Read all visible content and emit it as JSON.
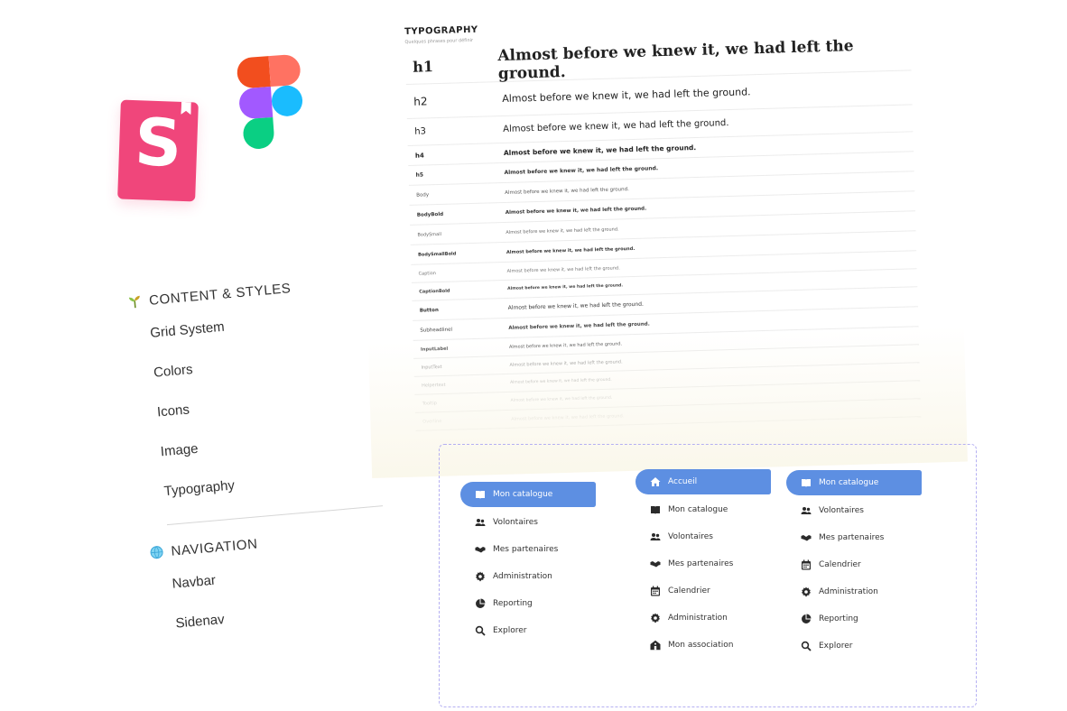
{
  "storybook_logo": {
    "letter": "S",
    "icon": "storybook-icon",
    "color": "#f0467b"
  },
  "figma_logo": {
    "icon": "figma-icon"
  },
  "left_nav": {
    "sections": [
      {
        "label": "CONTENT & STYLES",
        "icon": "sprout-icon",
        "items": [
          "Grid System",
          "Colors",
          "Icons",
          "Image",
          "Typography"
        ]
      },
      {
        "label": "NAVIGATION",
        "icon": "globe-icon",
        "items": [
          "Navbar",
          "Sidenav"
        ]
      }
    ]
  },
  "typography": {
    "title": "TYPOGRAPHY",
    "subtitle": "Quelques phrases pour définir",
    "sample": "Almost before we knew it, we had left the ground.",
    "rows": [
      {
        "name": "h1",
        "sample": "Almost before we knew it, we had left the ground."
      },
      {
        "name": "h2",
        "sample": "Almost before we knew it, we had left the ground."
      },
      {
        "name": "h3",
        "sample": "Almost before we knew it, we had left the ground."
      },
      {
        "name": "h4",
        "sample": "Almost before we knew it, we had left the ground."
      },
      {
        "name": "h5",
        "sample": "Almost before we knew it, we had left the ground."
      },
      {
        "name": "Body",
        "sample": "Almost before we knew it, we had left the ground."
      },
      {
        "name": "BodyBold",
        "sample": "Almost before we knew it, we had left the ground."
      },
      {
        "name": "BodySmall",
        "sample": "Almost before we knew it, we had left the ground."
      },
      {
        "name": "BodySmallBold",
        "sample": "Almost before we knew it, we had left the ground."
      },
      {
        "name": "Caption",
        "sample": "Almost before we knew it, we had left the ground."
      },
      {
        "name": "CaptionBold",
        "sample": "Almost before we knew it, we had left the ground."
      },
      {
        "name": "Button",
        "sample": "Almost before we knew it, we had left the ground."
      },
      {
        "name": "Subheadlinel",
        "sample": "Almost before we knew it, we had left the ground."
      },
      {
        "name": "InputLabel",
        "sample": "Almost before we knew it, we had left the ground."
      },
      {
        "name": "InputText",
        "sample": "Almost before we knew it, we had left the ground."
      },
      {
        "name": "Helpertext",
        "sample": "Almost before we knew it, we had left the ground."
      },
      {
        "name": "Tooltip",
        "sample": "Almost before we knew it, we had left the ground."
      },
      {
        "name": "Overline",
        "sample": "Almost before we knew it, we had left the ground."
      }
    ]
  },
  "menus": [
    {
      "items": [
        {
          "label": "Mon catalogue",
          "icon": "book-icon",
          "active": true
        },
        {
          "label": "Volontaires",
          "icon": "users-icon"
        },
        {
          "label": "Mes partenaires",
          "icon": "handshake-icon"
        },
        {
          "label": "Administration",
          "icon": "gear-icon"
        },
        {
          "label": "Reporting",
          "icon": "pie-chart-icon"
        },
        {
          "label": "Explorer",
          "icon": "search-icon"
        }
      ]
    },
    {
      "items": [
        {
          "label": "Accueil",
          "icon": "home-icon",
          "active": true
        },
        {
          "label": "Mon catalogue",
          "icon": "book-icon"
        },
        {
          "label": "Volontaires",
          "icon": "users-icon"
        },
        {
          "label": "Mes partenaires",
          "icon": "handshake-icon"
        },
        {
          "label": "Calendrier",
          "icon": "calendar-icon"
        },
        {
          "label": "Administration",
          "icon": "gear-icon"
        },
        {
          "label": "Mon association",
          "icon": "building-icon"
        }
      ]
    },
    {
      "items": [
        {
          "label": "Mon catalogue",
          "icon": "book-icon",
          "active": true
        },
        {
          "label": "Volontaires",
          "icon": "users-icon"
        },
        {
          "label": "Mes partenaires",
          "icon": "handshake-icon"
        },
        {
          "label": "Calendrier",
          "icon": "calendar-icon"
        },
        {
          "label": "Administration",
          "icon": "gear-icon"
        },
        {
          "label": "Reporting",
          "icon": "pie-chart-icon"
        },
        {
          "label": "Explorer",
          "icon": "search-icon"
        }
      ]
    }
  ],
  "colors": {
    "accent": "#5d8fe2",
    "storybook": "#f0467b",
    "dashed_border": "#b5b0f2"
  }
}
